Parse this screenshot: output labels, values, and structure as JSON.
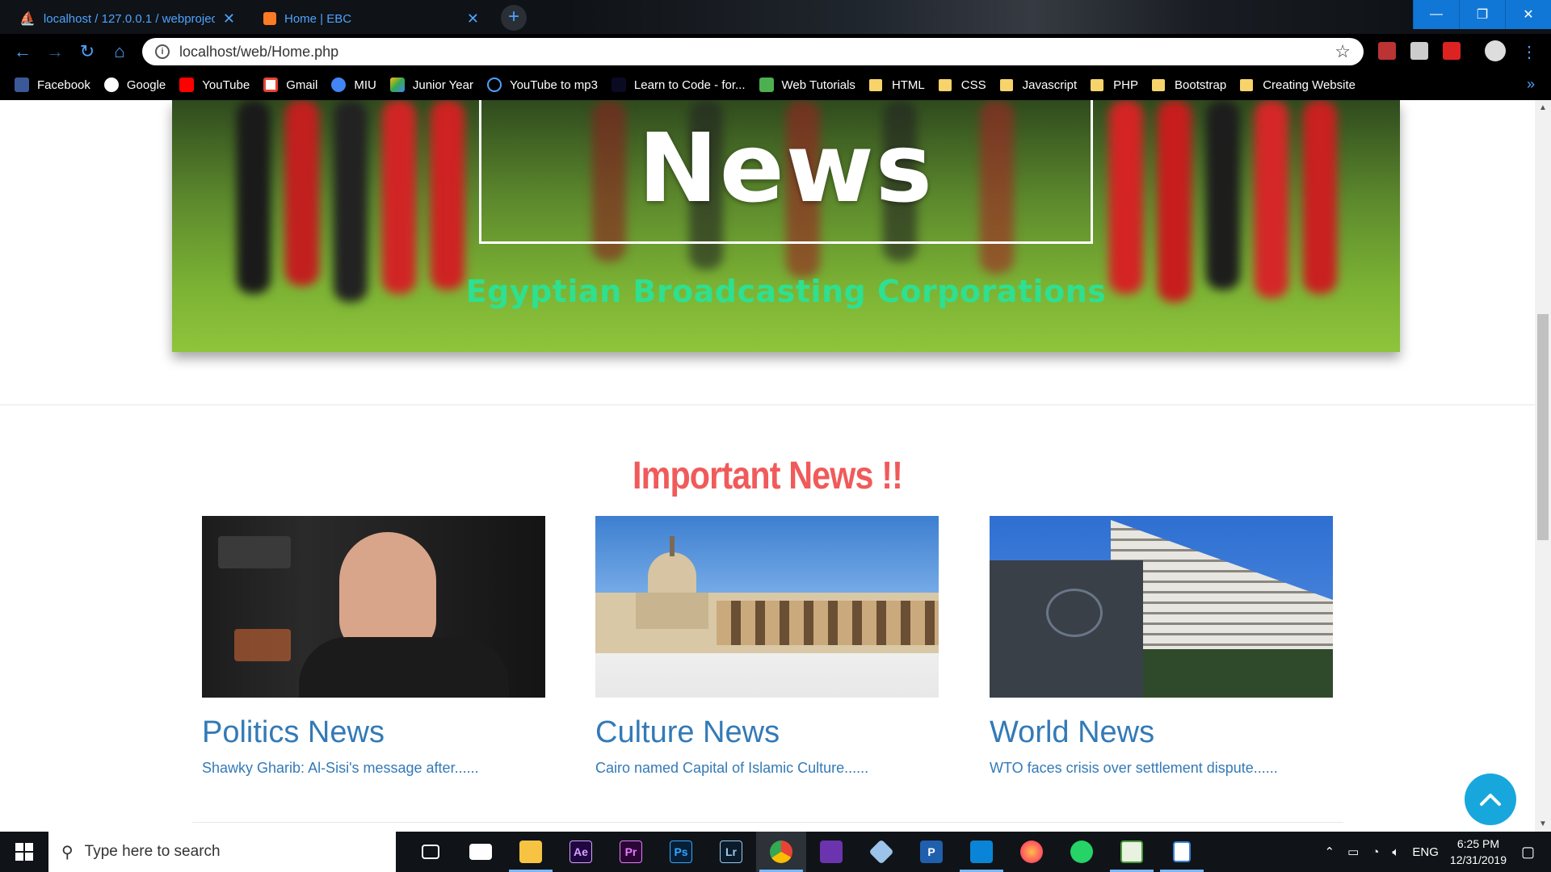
{
  "browser": {
    "tabs": [
      {
        "title": "localhost / 127.0.0.1 / webprojec"
      },
      {
        "title": "Home | EBC"
      }
    ],
    "url": "localhost/web/Home.php",
    "bookmarks": [
      {
        "label": "Facebook",
        "icon": "facebook-icon",
        "color": "#3b5998"
      },
      {
        "label": "Google",
        "icon": "google-icon",
        "color": "#ffffff"
      },
      {
        "label": "YouTube",
        "icon": "youtube-icon",
        "color": "#ff0000"
      },
      {
        "label": "Gmail",
        "icon": "gmail-icon",
        "color": "#ea4335"
      },
      {
        "label": "MIU",
        "icon": "globe-icon",
        "color": "#4285f4"
      },
      {
        "label": "Junior Year",
        "icon": "drive-icon",
        "color": "#34a853"
      },
      {
        "label": "YouTube to mp3",
        "icon": "headphones-icon",
        "color": "#4da3ff"
      },
      {
        "label": "Learn to Code - for...",
        "icon": "freecodecamp-icon",
        "color": "#0a0a23"
      },
      {
        "label": "Web Tutorials",
        "icon": "w3-icon",
        "color": "#4caf50"
      },
      {
        "label": "HTML",
        "icon": "folder-icon"
      },
      {
        "label": "CSS",
        "icon": "folder-icon"
      },
      {
        "label": "Javascript",
        "icon": "folder-icon"
      },
      {
        "label": "PHP",
        "icon": "folder-icon"
      },
      {
        "label": "Bootstrap",
        "icon": "folder-icon"
      },
      {
        "label": "Creating Website",
        "icon": "folder-icon"
      }
    ]
  },
  "hero": {
    "title": "News",
    "subtitle": "Egyptian Broadcasting Corporations"
  },
  "section": {
    "title": "Important News !!"
  },
  "cards": [
    {
      "heading": "Politics News",
      "link": "Shawky Gharib: Al-Sisi's message after......"
    },
    {
      "heading": "Culture News",
      "link": "Cairo named Capital of Islamic Culture......"
    },
    {
      "heading": "World News",
      "link": "WTO faces crisis over settlement dispute......"
    }
  ],
  "taskbar": {
    "search_placeholder": "Type here to search",
    "language": "ENG",
    "time": "6:25 PM",
    "date": "12/31/2019"
  },
  "colors": {
    "accent_link": "#337ab7",
    "section_title": "#f15a5a",
    "hero_subtitle": "#2ee08f",
    "back_to_top": "#18a7dd"
  }
}
